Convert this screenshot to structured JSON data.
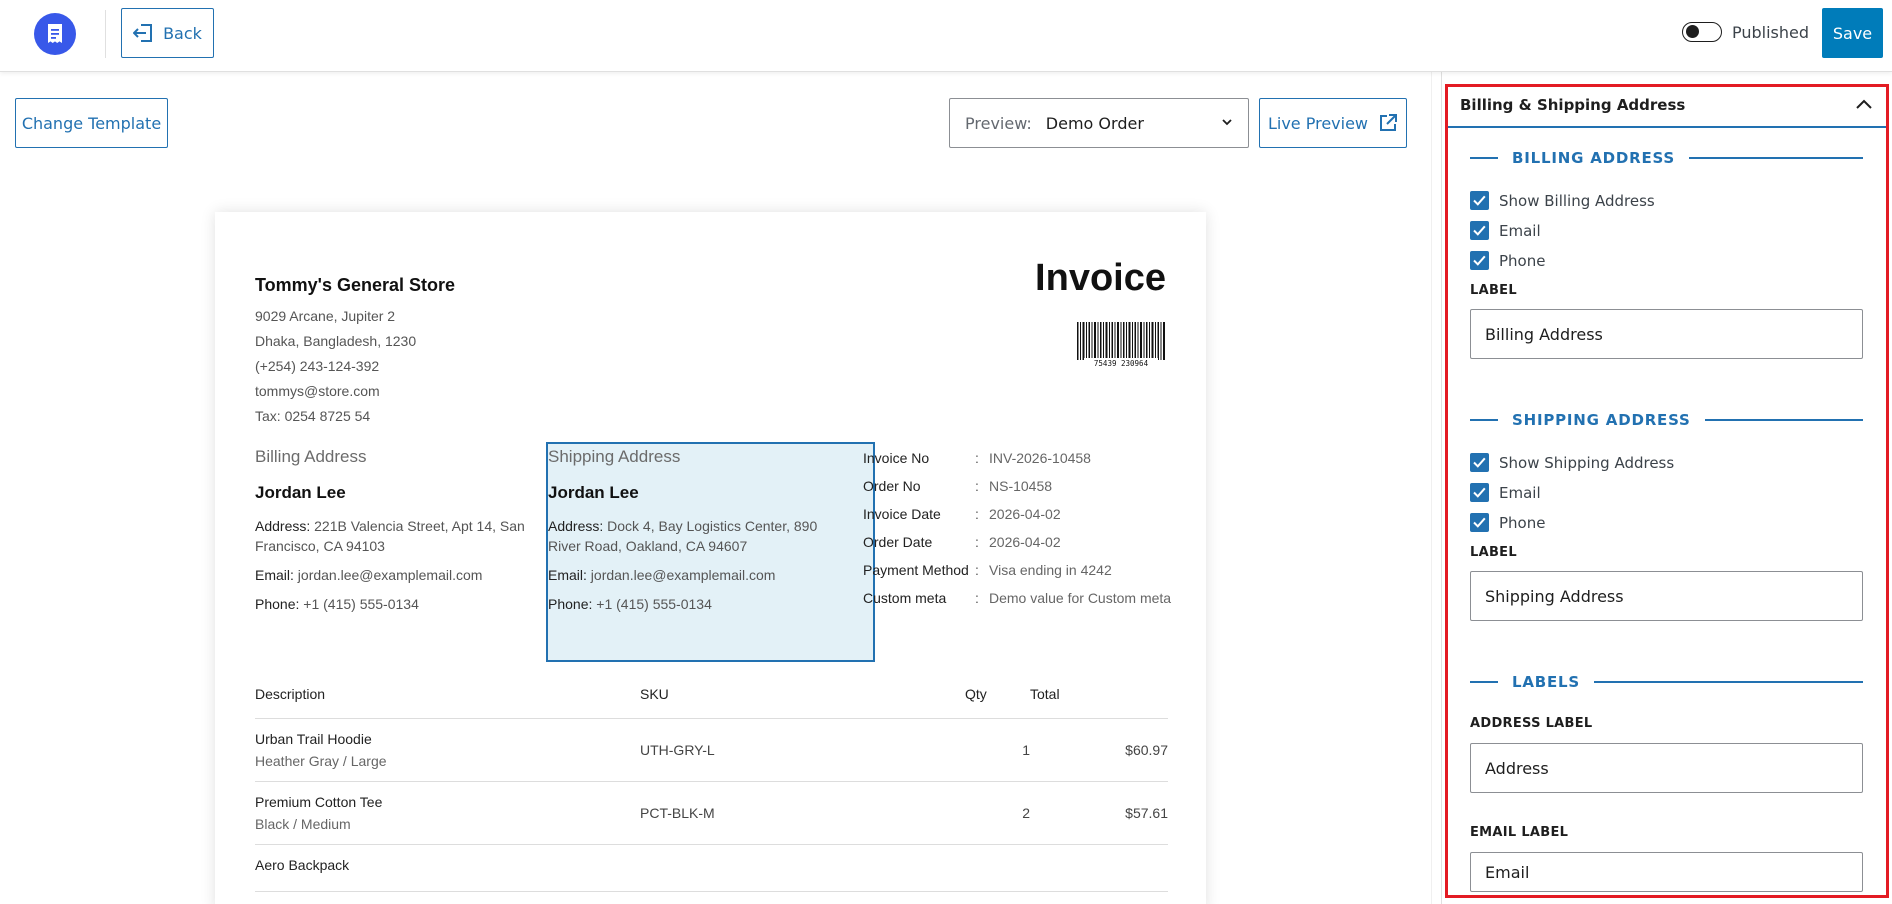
{
  "topbar": {
    "back_label": "Back",
    "published_label": "Published",
    "published_on": false,
    "save_label": "Save"
  },
  "toolbar": {
    "change_template_label": "Change Template",
    "preview_prefix": "Preview:",
    "preview_value": "Demo Order",
    "live_preview_label": "Live Preview"
  },
  "invoice": {
    "store_name": "Tommy's General Store",
    "store_lines": [
      "9029 Arcane, Jupiter 2",
      "Dhaka, Bangladesh, 1230",
      "(+254) 243-124-392",
      "tommys@store.com",
      "Tax: 0254 8725 54"
    ],
    "title": "Invoice",
    "barcode_text": "75439 230964",
    "billing": {
      "title": "Billing Address",
      "name": "Jordan Lee",
      "address_key": "Address:",
      "address": "221B Valencia Street, Apt 14, San Francisco, CA 94103",
      "email_key": "Email:",
      "email": "jordan.lee@examplemail.com",
      "phone_key": "Phone:",
      "phone": "+1 (415) 555-0134"
    },
    "shipping": {
      "title": "Shipping Address",
      "name": "Jordan Lee",
      "address_key": "Address:",
      "address": "Dock 4, Bay Logistics Center, 890 River Road, Oakland, CA 94607",
      "email_key": "Email:",
      "email": "jordan.lee@examplemail.com",
      "phone_key": "Phone:",
      "phone": "+1 (415) 555-0134"
    },
    "meta": [
      {
        "key": "Invoice No",
        "value": "INV-2026-10458"
      },
      {
        "key": "Order No",
        "value": "NS-10458"
      },
      {
        "key": "Invoice Date",
        "value": "2026-04-02"
      },
      {
        "key": "Order Date",
        "value": "2026-04-02"
      },
      {
        "key": "Payment Method",
        "value": "Visa ending in 4242"
      },
      {
        "key": "Custom meta",
        "value": "Demo value for Custom meta"
      }
    ],
    "table": {
      "headers": [
        "Description",
        "SKU",
        "Qty",
        "Total"
      ],
      "rows": [
        {
          "name": "Urban Trail Hoodie",
          "variant": "Heather Gray / Large",
          "sku": "UTH-GRY-L",
          "qty": "1",
          "total": "$60.97"
        },
        {
          "name": "Premium Cotton Tee",
          "variant": "Black / Medium",
          "sku": "PCT-BLK-M",
          "qty": "2",
          "total": "$57.61"
        },
        {
          "name": "Aero Backpack",
          "variant": "",
          "sku": "",
          "qty": "",
          "total": ""
        }
      ]
    }
  },
  "panel": {
    "header": "Billing & Shipping Address",
    "billing_section": "BILLING ADDRESS",
    "billing_checks": [
      "Show Billing Address",
      "Email",
      "Phone"
    ],
    "billing_label_title": "LABEL",
    "billing_label_value": "Billing Address",
    "shipping_section": "SHIPPING ADDRESS",
    "shipping_checks": [
      "Show Shipping Address",
      "Email",
      "Phone"
    ],
    "shipping_label_title": "LABEL",
    "shipping_label_value": "Shipping Address",
    "labels_section": "LABELS",
    "address_label_title": "ADDRESS LABEL",
    "address_label_value": "Address",
    "email_label_title": "EMAIL LABEL",
    "email_label_value": "Email"
  },
  "colors": {
    "accent": "#2271b1",
    "save": "#007cba",
    "logo": "#3858e9",
    "highlight_frame": "#e31b23",
    "highlight_fill": "#e3f1f7"
  }
}
